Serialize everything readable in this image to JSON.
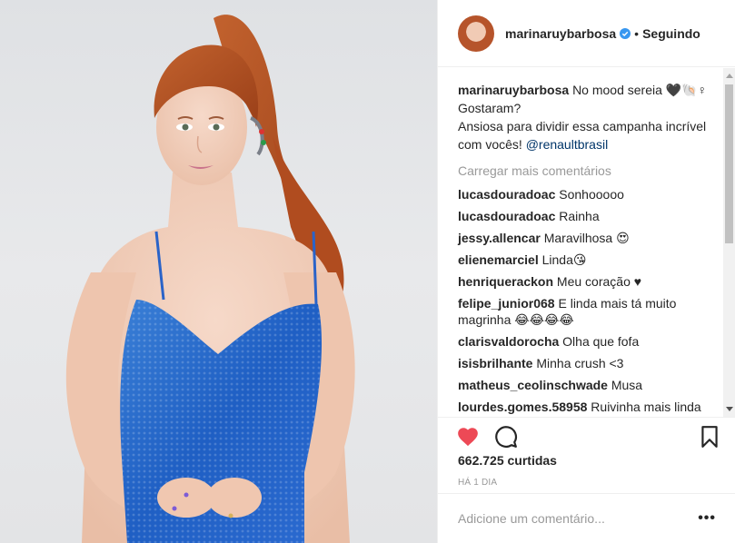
{
  "header": {
    "username": "marinaruybarbosa",
    "separator": "•",
    "follow_label": "Seguindo"
  },
  "caption": {
    "username": "marinaruybarbosa",
    "line1": "No mood sereia 🖤🐚♀",
    "line2": "Gostaram?",
    "line3": "Ansiosa para dividir essa campanha incrível com vocês!",
    "mention": "@renaultbrasil"
  },
  "load_more": "Carregar mais comentários",
  "comments": [
    {
      "user": "lucasdouradoac",
      "text": "Sonhooooo"
    },
    {
      "user": "lucasdouradoac",
      "text": "Rainha"
    },
    {
      "user": "jessy.allencar",
      "text": "Maravilhosa 😍"
    },
    {
      "user": "elienemarciel",
      "text": "Linda😘"
    },
    {
      "user": "henriquerackon",
      "text": "Meu coração ♥"
    },
    {
      "user": "felipe_junior068",
      "text": "E linda mais tá muito magrinha 😂😂😂😂"
    },
    {
      "user": "clarisvaldorocha",
      "text": "Olha que fofa"
    },
    {
      "user": "isisbrilhante",
      "text": "Minha crush <3"
    },
    {
      "user": "matheus_ceolinschwade",
      "text": "Musa"
    },
    {
      "user": "lourdes.gomes.58958",
      "text": "Ruivinha mais linda do Brasil! Obg pra seus cabelos e lembra"
    }
  ],
  "likes": "662.725 curtidas",
  "time": "HÁ 1 DIA",
  "add_comment": {
    "placeholder": "Adicione um comentário..."
  },
  "more_options": "•••",
  "colors": {
    "heart": "#ed4956",
    "verified": "#3897f0",
    "mention": "#003569"
  },
  "icons": [
    "heart-filled-icon",
    "comment-icon",
    "bookmark-icon",
    "verified-badge-icon"
  ]
}
